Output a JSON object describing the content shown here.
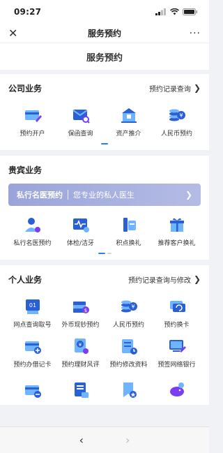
{
  "status": {
    "time": "09:27"
  },
  "nav": {
    "title": "服务预约",
    "close": "✕",
    "more": "···"
  },
  "page_header": "服务预约",
  "company": {
    "title": "公司业务",
    "link": "预约记录查询",
    "items": [
      {
        "label": "预约开户",
        "icon": "card-pen-icon"
      },
      {
        "label": "保函查询",
        "icon": "envelope-search-icon"
      },
      {
        "label": "资产推介",
        "icon": "bank-building-icon"
      },
      {
        "label": "人民币预约",
        "icon": "coin-stack-yuan-icon"
      }
    ]
  },
  "vip": {
    "title": "贵宾业务",
    "banner_title": "私行名医预约",
    "banner_sub": "您专业的私人医生",
    "items": [
      {
        "label": "私行名医预约",
        "icon": "doctor-icon"
      },
      {
        "label": "体检/洁牙",
        "icon": "health-monitor-icon"
      },
      {
        "label": "积点换礼",
        "icon": "points-card-icon"
      },
      {
        "label": "推荐客户换礼",
        "icon": "gift-box-icon"
      }
    ]
  },
  "personal": {
    "title": "个人业务",
    "link": "预约记录查询与修改",
    "items": [
      {
        "label": "网点查询取号",
        "icon": "queue-ticket-icon"
      },
      {
        "label": "外币现钞预约",
        "icon": "cash-stack-icon"
      },
      {
        "label": "人民币预约",
        "icon": "coin-stack-yuan-icon"
      },
      {
        "label": "预约换卡",
        "icon": "card-exchange-icon"
      },
      {
        "label": "预约办借记卡",
        "icon": "debit-card-add-icon"
      },
      {
        "label": "预约理财风评",
        "icon": "finance-assessment-icon"
      },
      {
        "label": "预约修改资料",
        "icon": "profile-edit-icon"
      },
      {
        "label": "预签网络银行",
        "icon": "online-banking-icon"
      }
    ],
    "more_items": [
      {
        "icon": "card-minus-icon"
      },
      {
        "icon": "document-super-icon"
      },
      {
        "icon": "bookmark-star-icon"
      },
      {
        "icon": "piggy-bank-icon"
      }
    ]
  },
  "bottom": {
    "back": "‹",
    "forward": "›"
  },
  "colors": {
    "primary": "#2c7df7",
    "icon_dark": "#2a5fd6",
    "icon_light": "#6fb4ff",
    "banner": "#a3acdf"
  }
}
